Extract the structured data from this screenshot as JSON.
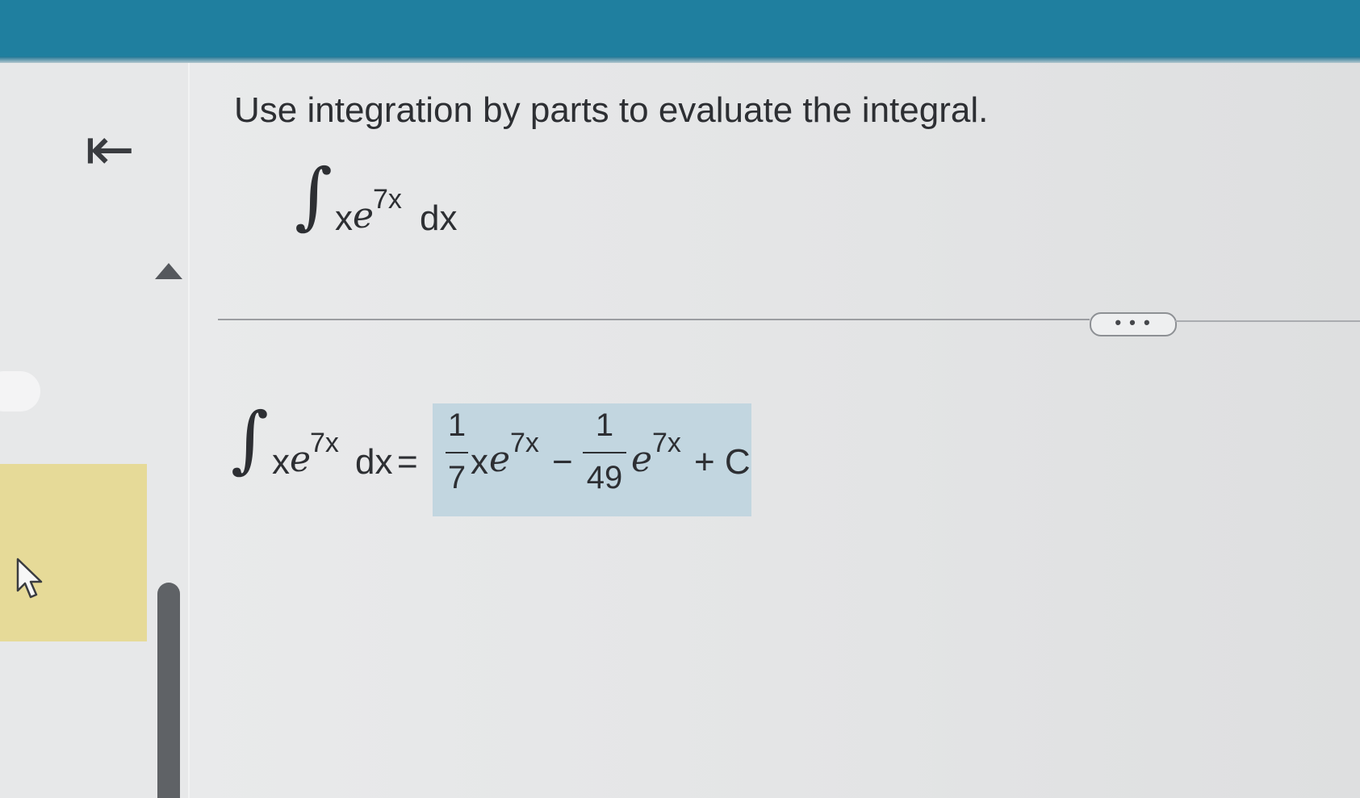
{
  "sidebar": {
    "collapse_glyph": "⇤",
    "collapse_icon": "collapse-left-icon",
    "scroll_up_icon": "triangle-up-icon",
    "pointer_icon": "mouse-pointer-icon"
  },
  "question": {
    "prompt": "Use integration by parts to evaluate the integral.",
    "integrand_x": "x",
    "integrand_e": "e",
    "exponent": "7x",
    "differential": "dx"
  },
  "divider": {
    "more_label": "• • •"
  },
  "answer": {
    "lhs_x": "x",
    "lhs_e": "e",
    "lhs_exponent": "7x",
    "lhs_dx": "dx",
    "equals": "=",
    "term1_numerator": "1",
    "term1_denominator": "7",
    "term1_x": "x",
    "term1_e": "e",
    "term1_exponent": "7x",
    "minus": "−",
    "term2_numerator": "1",
    "term2_denominator": "49",
    "term2_e": "e",
    "term2_exponent": "7x",
    "plus_c": "+ C"
  },
  "colors": {
    "header": "#1f7f9f",
    "answer_highlight": "#c2d6e0",
    "yellow_panel": "#e6da98"
  }
}
